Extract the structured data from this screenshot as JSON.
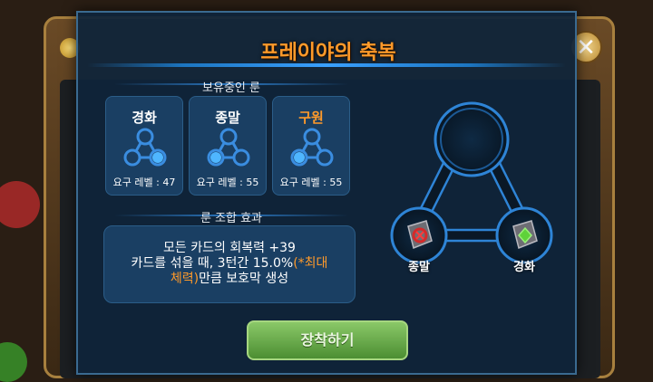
{
  "dialog": {
    "title": "프레이야의 축복",
    "owned_runes_label": "보유중인 룬",
    "combo_effect_label": "룬 조합 효과",
    "equip_button": "장착하기"
  },
  "runes": [
    {
      "name": "경화",
      "level_text": "요구 레벨 : 47",
      "highlight": false
    },
    {
      "name": "종말",
      "level_text": "요구 레벨 : 55",
      "highlight": false
    },
    {
      "name": "구원",
      "level_text": "요구 레벨 : 55",
      "highlight": true
    }
  ],
  "effect": {
    "line1": "모든 카드의 회복력 +39",
    "line2_prefix": "카드를 섞을 때, 3턴간 15.0%",
    "line2_highlight": "(*최대",
    "line3_highlight": "체력)",
    "line3_suffix": "만큼 보호막 생성"
  },
  "diagram": {
    "left_node_label": "종말",
    "right_node_label": "경화"
  },
  "colors": {
    "accent_orange": "#ff9a2a",
    "panel_blue": "#1a3f63",
    "button_green": "#6aaa4a"
  }
}
